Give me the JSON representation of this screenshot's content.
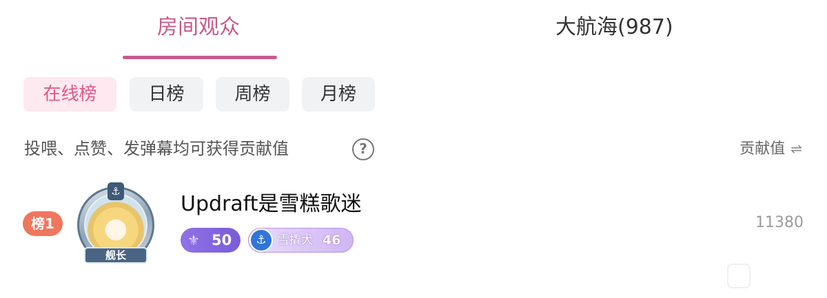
{
  "tabs": [
    {
      "label": "房间观众",
      "active": true
    },
    {
      "label": "大航海(987)",
      "active": false
    }
  ],
  "filters": [
    {
      "label": "在线榜",
      "active": true
    },
    {
      "label": "日榜",
      "active": false
    },
    {
      "label": "周榜",
      "active": false
    },
    {
      "label": "月榜",
      "active": false
    }
  ],
  "hint": "投喂、点赞、发弹幕均可获得贡献值",
  "help_icon": "?",
  "sort": {
    "label": "贡献值",
    "icon": "swap-icon"
  },
  "ranking": [
    {
      "rank_label": "榜1",
      "username": "Updraft是雪糕歌迷",
      "avatar_anchor": "⚓",
      "avatar_ribbon": "舰长",
      "level": "50",
      "medal": {
        "name": "雪撬犬",
        "level": "46"
      },
      "contribution": "11380"
    }
  ],
  "colors": {
    "accent": "#c75b8e",
    "chip_active_bg": "#fde9ef",
    "rank_badge": "#f0765e",
    "level_badge": "#8f73e6",
    "medal_anchor": "#2f76d9"
  }
}
